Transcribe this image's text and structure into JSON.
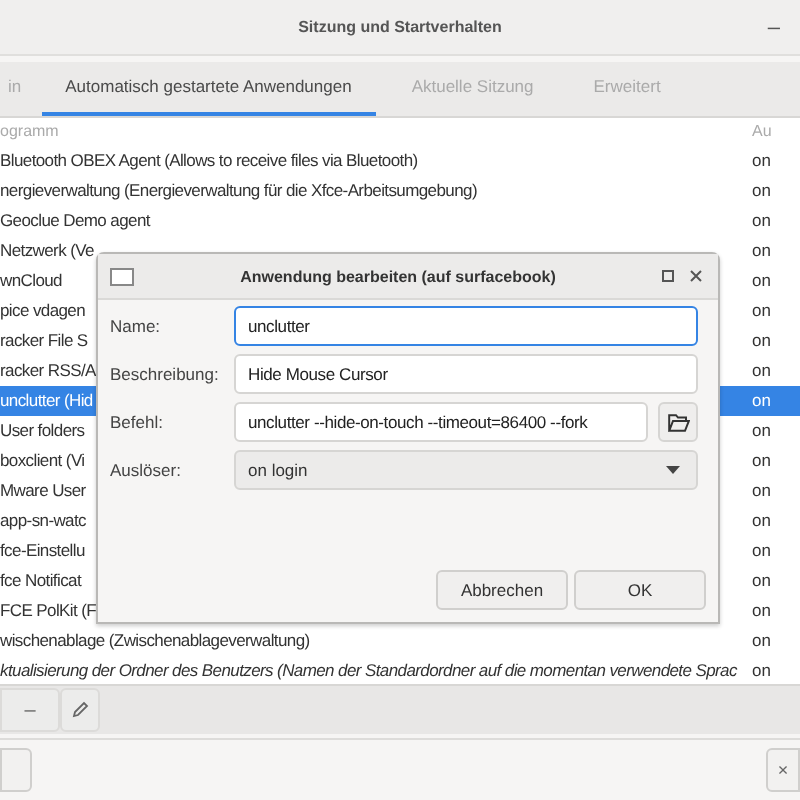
{
  "window": {
    "title": "Sitzung und Startverhalten",
    "minimize": "–"
  },
  "tabs": [
    {
      "label": "in",
      "selected": false
    },
    {
      "label": "Automatisch gestartete Anwendungen",
      "selected": true
    },
    {
      "label": "Aktuelle Sitzung",
      "selected": false
    },
    {
      "label": "Erweitert",
      "selected": false
    }
  ],
  "table": {
    "columns": [
      "ogramm",
      "Au"
    ],
    "rows": [
      {
        "name": "Bluetooth OBEX Agent (Allows to receive files via Bluetooth)",
        "trigger": "on",
        "selected": false,
        "italic": false
      },
      {
        "name": "nergieverwaltung (Energieverwaltung für die Xfce-Arbeitsumgebung)",
        "trigger": "on",
        "selected": false,
        "italic": false
      },
      {
        "name": "Geoclue Demo agent",
        "trigger": "on",
        "selected": false,
        "italic": false
      },
      {
        "name": "Netzwerk (Ve",
        "trigger": "on",
        "selected": false,
        "italic": false
      },
      {
        "name": "wnCloud",
        "trigger": "on",
        "selected": false,
        "italic": false
      },
      {
        "name": "pice vdagen",
        "trigger": "on",
        "selected": false,
        "italic": false
      },
      {
        "name": "racker File S",
        "trigger": "on",
        "selected": false,
        "italic": false
      },
      {
        "name": "racker RSS/A",
        "trigger": "on",
        "selected": false,
        "italic": false
      },
      {
        "name": "unclutter (Hid",
        "trigger": "on",
        "selected": true,
        "italic": false
      },
      {
        "name": "User folders",
        "trigger": "on",
        "selected": false,
        "italic": false
      },
      {
        "name": "boxclient (Vi",
        "trigger": "on",
        "selected": false,
        "italic": false
      },
      {
        "name": "Mware User",
        "trigger": "on",
        "selected": false,
        "italic": false
      },
      {
        "name": "app-sn-watc",
        "trigger": "on",
        "selected": false,
        "italic": false
      },
      {
        "name": "fce-Einstellu",
        "trigger": "on",
        "selected": false,
        "italic": false
      },
      {
        "name": "fce Notificat",
        "trigger": "on",
        "selected": false,
        "italic": false
      },
      {
        "name": "FCE PolKit (F",
        "trigger": "on",
        "selected": false,
        "italic": false
      },
      {
        "name": "wischenablage (Zwischenablageverwaltung)",
        "trigger": "on",
        "selected": false,
        "italic": false
      },
      {
        "name": "ktualisierung der Ordner des Benutzers (Namen der Standardordner auf die momentan verwendete Sprac",
        "trigger": "on",
        "selected": false,
        "italic": true
      }
    ]
  },
  "toolbar": {
    "remove": "–"
  },
  "bottom": {
    "close": "×"
  },
  "dialog": {
    "title": "Anwendung bearbeiten (auf surfacebook)",
    "fields": [
      {
        "label": "Name:",
        "value": "unclutter",
        "focused": true
      },
      {
        "label": "Beschreibung:",
        "value": "Hide Mouse Cursor",
        "focused": false
      },
      {
        "label": "Befehl:",
        "value": "unclutter --hide-on-touch --timeout=86400 --fork",
        "focused": false
      }
    ],
    "trigger": {
      "label": "Auslöser:",
      "value": "on login"
    },
    "buttons": [
      "Abbrechen",
      "OK"
    ]
  }
}
